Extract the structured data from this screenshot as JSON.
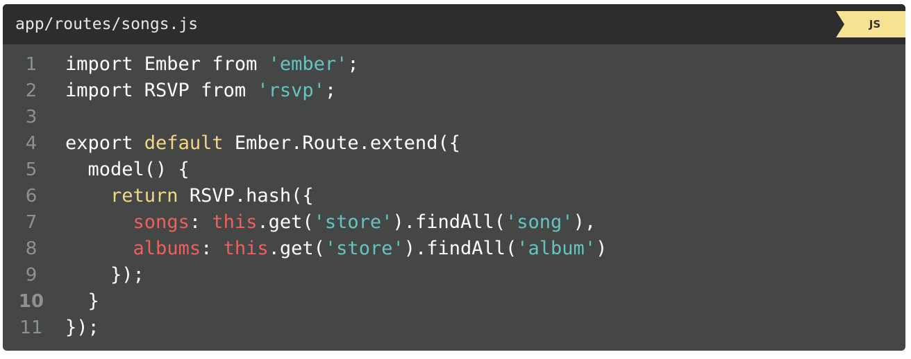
{
  "header": {
    "filename": "app/routes/songs.js",
    "language": "JS"
  },
  "colors": {
    "background": "#444746",
    "header_background": "#2c2d2c",
    "badge": "#f6e293",
    "string": "#67c3be",
    "keyword": "#f3d783",
    "property": "#f05f5c",
    "line_number": "#8e9190"
  },
  "code": {
    "lines": [
      {
        "number": "1",
        "tokens": [
          {
            "type": "plain",
            "text": "import Ember from "
          },
          {
            "type": "str",
            "text": "'ember'"
          },
          {
            "type": "plain",
            "text": ";"
          }
        ]
      },
      {
        "number": "2",
        "tokens": [
          {
            "type": "plain",
            "text": "import RSVP from "
          },
          {
            "type": "str",
            "text": "'rsvp'"
          },
          {
            "type": "plain",
            "text": ";"
          }
        ]
      },
      {
        "number": "3",
        "tokens": []
      },
      {
        "number": "4",
        "tokens": [
          {
            "type": "plain",
            "text": "export "
          },
          {
            "type": "kw",
            "text": "default"
          },
          {
            "type": "plain",
            "text": " Ember.Route.extend({"
          }
        ]
      },
      {
        "number": "5",
        "tokens": [
          {
            "type": "plain",
            "text": "  model() {"
          }
        ]
      },
      {
        "number": "6",
        "tokens": [
          {
            "type": "plain",
            "text": "    "
          },
          {
            "type": "kw",
            "text": "return"
          },
          {
            "type": "plain",
            "text": " RSVP.hash({"
          }
        ]
      },
      {
        "number": "7",
        "tokens": [
          {
            "type": "plain",
            "text": "      "
          },
          {
            "type": "key",
            "text": "songs"
          },
          {
            "type": "plain",
            "text": ": "
          },
          {
            "type": "this",
            "text": "this"
          },
          {
            "type": "plain",
            "text": ".get("
          },
          {
            "type": "str",
            "text": "'store'"
          },
          {
            "type": "plain",
            "text": ").findAll("
          },
          {
            "type": "str",
            "text": "'song'"
          },
          {
            "type": "plain",
            "text": "),"
          }
        ]
      },
      {
        "number": "8",
        "tokens": [
          {
            "type": "plain",
            "text": "      "
          },
          {
            "type": "key",
            "text": "albums"
          },
          {
            "type": "plain",
            "text": ": "
          },
          {
            "type": "this",
            "text": "this"
          },
          {
            "type": "plain",
            "text": ".get("
          },
          {
            "type": "str",
            "text": "'store'"
          },
          {
            "type": "plain",
            "text": ").findAll("
          },
          {
            "type": "str",
            "text": "'album'"
          },
          {
            "type": "plain",
            "text": ")"
          }
        ]
      },
      {
        "number": "9",
        "tokens": [
          {
            "type": "plain",
            "text": "    });"
          }
        ]
      },
      {
        "number": "10",
        "tokens": [
          {
            "type": "plain",
            "text": "  }"
          }
        ]
      },
      {
        "number": "11",
        "tokens": [
          {
            "type": "plain",
            "text": "});"
          }
        ]
      }
    ]
  }
}
